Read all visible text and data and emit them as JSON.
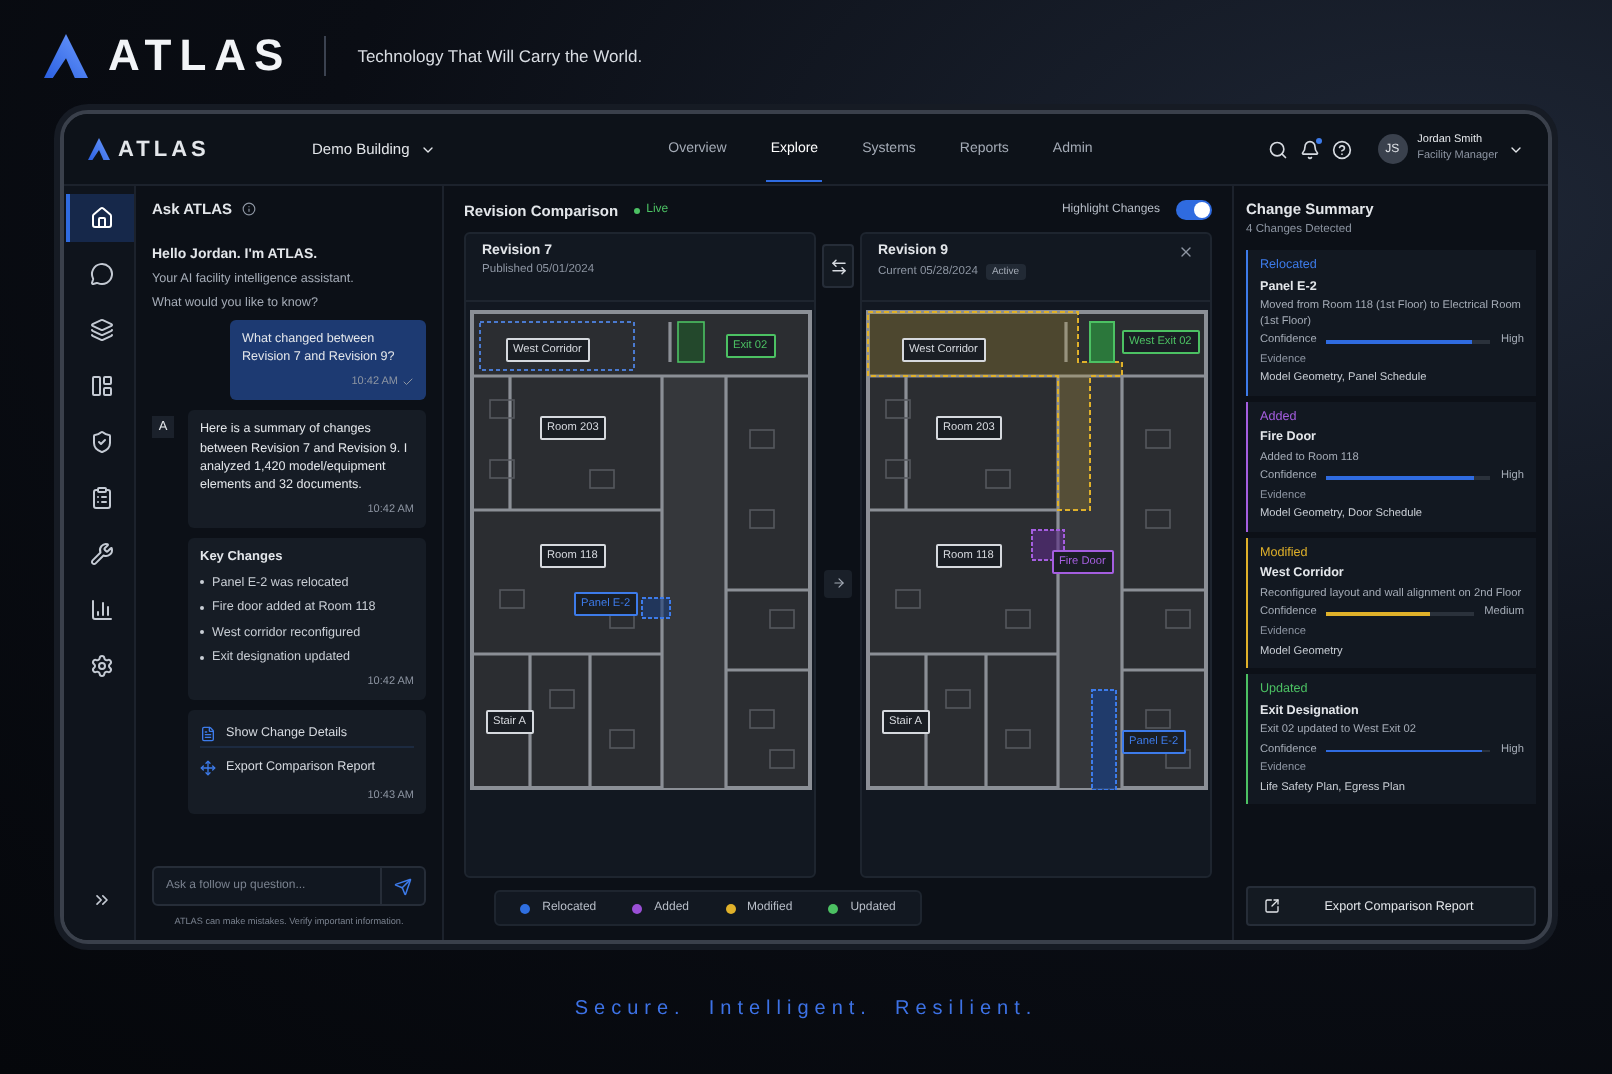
{
  "brand": {
    "logo": "ATLAS",
    "tagline": "Technology That Will Carry the World."
  },
  "nav": {
    "logo": "ATLAS",
    "building": "Demo Building",
    "tabs": [
      {
        "label": "Overview",
        "selected": false
      },
      {
        "label": "Explore",
        "selected": true
      },
      {
        "label": "Systems",
        "selected": false
      },
      {
        "label": "Reports",
        "selected": false
      },
      {
        "label": "Admin",
        "selected": false
      }
    ],
    "notification": true,
    "user": {
      "initials": "JS",
      "name": "Jordan Smith",
      "role": "Facility Manager"
    }
  },
  "rail": {
    "items": [
      {
        "selected": true
      },
      {
        "selected": false
      },
      {
        "selected": false
      },
      {
        "selected": false
      },
      {
        "selected": false
      },
      {
        "selected": false
      },
      {
        "selected": false
      },
      {
        "selected": false
      },
      {
        "selected": false
      }
    ]
  },
  "chat": {
    "title": "Ask ATLAS",
    "greeting": "Hello Jordan. I'm ATLAS.",
    "intro": [
      "Your AI facility intelligence assistant.",
      "What would you like to know?"
    ],
    "messages": [
      {
        "kind": "user",
        "text": "What changed between Revision 7 and Revision 9?",
        "time": "10:42 AM"
      },
      {
        "kind": "assistant",
        "avatar": "A",
        "text": "Here is a summary of changes between Revision 7 and Revision 9. I analyzed 1,420 model/equipment elements and 32 documents.",
        "time": "10:42 AM"
      },
      {
        "kind": "list",
        "title": "Key Changes",
        "items": [
          "Panel E-2 was relocated",
          "Fire door added at Room 118",
          "West corridor reconfigured",
          "Exit designation updated"
        ],
        "time": "10:42 AM"
      },
      {
        "kind": "actions",
        "actions": [
          "Show Change Details",
          "Export Comparison Report"
        ],
        "time": "10:43 AM"
      }
    ],
    "input": {
      "placeholder": "Ask a follow up question..."
    },
    "disclaimer": "ATLAS can make mistakes. Verify important information."
  },
  "comparison": {
    "title": "Revision Comparison",
    "status": "Live",
    "highlight": {
      "label": "Highlight Changes",
      "on": true
    },
    "panes": [
      {
        "title": "Revision 7",
        "subtitle": "Published 05/01/2024",
        "closable": false,
        "labels": [
          {
            "text": "West Corridor",
            "color": "#d6d9de"
          },
          {
            "text": "Exit 02",
            "color": "#4cc163"
          },
          {
            "text": "Room 203",
            "color": "#d6d9de"
          },
          {
            "text": "Room 118",
            "color": "#d6d9de"
          },
          {
            "text": "Panel E-2",
            "color": "#3d7bea"
          },
          {
            "text": "Stair A",
            "color": "#d6d9de"
          }
        ]
      },
      {
        "title": "Revision 9",
        "subtitle": "Current 05/28/2024",
        "badge": "Active",
        "closable": true,
        "labels": [
          {
            "text": "West Corridor",
            "color": "#d6d9de"
          },
          {
            "text": "West Exit 02",
            "color": "#4cc163"
          },
          {
            "text": "Room 203",
            "color": "#d6d9de"
          },
          {
            "text": "Room 118",
            "color": "#d6d9de"
          },
          {
            "text": "Fire Door",
            "color": "#a55ee0"
          },
          {
            "text": "Panel E-2",
            "color": "#3d7bea"
          },
          {
            "text": "Stair A",
            "color": "#d6d9de"
          }
        ]
      }
    ],
    "legend": [
      {
        "label": "Relocated",
        "color": "#2f6fe0"
      },
      {
        "label": "Added",
        "color": "#9a4fd6"
      },
      {
        "label": "Modified",
        "color": "#e0b12a"
      },
      {
        "label": "Updated",
        "color": "#4cc163"
      }
    ]
  },
  "summary": {
    "title": "Change Summary",
    "count": "4 Changes Detected",
    "changes": [
      {
        "type": "Relocated",
        "color": "#3d7bea",
        "item": "Panel E-2",
        "description": "Moved from Room 118 (1st Floor) to Electrical Room (1st Floor)",
        "confidence_label": "Confidence",
        "level": 0.88,
        "confidence": "High",
        "evidence_label": "Evidence",
        "evidence": "Model Geometry, Panel Schedule"
      },
      {
        "type": "Added",
        "color": "#a55ee0",
        "item": "Fire Door",
        "description": "Added to Room 118",
        "confidence_label": "Confidence",
        "level": 0.9,
        "confidence": "High",
        "evidence_label": "Evidence",
        "evidence": "Model Geometry, Door Schedule"
      },
      {
        "type": "Modified",
        "color": "#e0b12a",
        "item": "West Corridor",
        "description": "Reconfigured layout and wall alignment on 2nd Floor",
        "confidence_label": "Confidence",
        "level": 0.7,
        "confidence": "Medium",
        "evidence_label": "Evidence",
        "evidence": "Model Geometry"
      },
      {
        "type": "Updated",
        "color": "#4cc163",
        "item": "Exit Designation",
        "description": "Exit 02 updated to West Exit 02",
        "confidence_label": "Confidence",
        "level": 0.95,
        "confidence": "High",
        "evidence_label": "Evidence",
        "evidence": "Life Safety Plan, Egress Plan"
      }
    ],
    "export": "Export Comparison Report"
  },
  "footer": {
    "tagline": "Secure.  Intelligent.  Resilient."
  }
}
